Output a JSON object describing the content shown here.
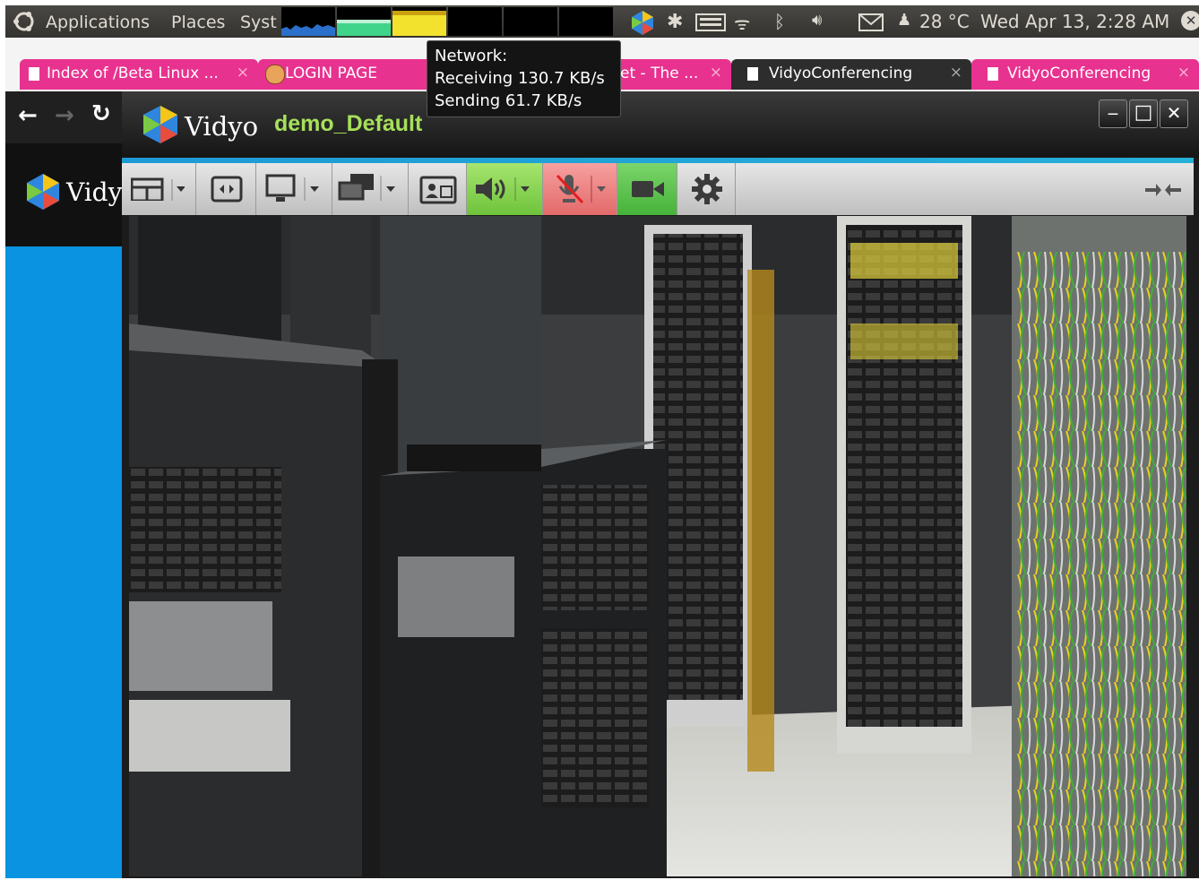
{
  "panel": {
    "menus": [
      "Applications",
      "Places",
      "Syst"
    ],
    "temperature": "28 °C",
    "datetime": "Wed Apr 13,  2:28 AM",
    "icons": [
      "ubuntu-logo-icon",
      "vidyo-tray-icon",
      "settings-tray-icon",
      "keyboard-icon",
      "wifi-icon",
      "bluetooth-icon",
      "volume-icon",
      "mail-icon",
      "user-icon",
      "close-icon"
    ]
  },
  "tooltip": {
    "title": "Network:",
    "receiving": "Receiving 130.7 KB/s",
    "sending": "Sending 61.7 KB/s"
  },
  "tabs": [
    {
      "label": "Index of /Beta Linux ...",
      "close": "×"
    },
    {
      "label": "LOGIN PAGE",
      "close": ""
    },
    {
      "label": "et - The ...",
      "close": "×"
    },
    {
      "label": "VidyoConferencing",
      "close": "×"
    },
    {
      "label": "VidyoConferencing",
      "close": "×"
    }
  ],
  "page": {
    "logo_text": "Vidy"
  },
  "vidyo": {
    "logo_text": "Vidyo",
    "room_name": "demo_Default",
    "minimize": "‒",
    "maximize": "□",
    "close": "✕"
  },
  "colors": {
    "tab_pink": "#e8328f",
    "accent_blue": "#1e9ad6",
    "page_blue": "#0a93e0",
    "room_green": "#a6e05a",
    "speaker_green": "#8fd65a",
    "mic_red": "#e97c7c",
    "camera_green": "#5cc44a"
  }
}
